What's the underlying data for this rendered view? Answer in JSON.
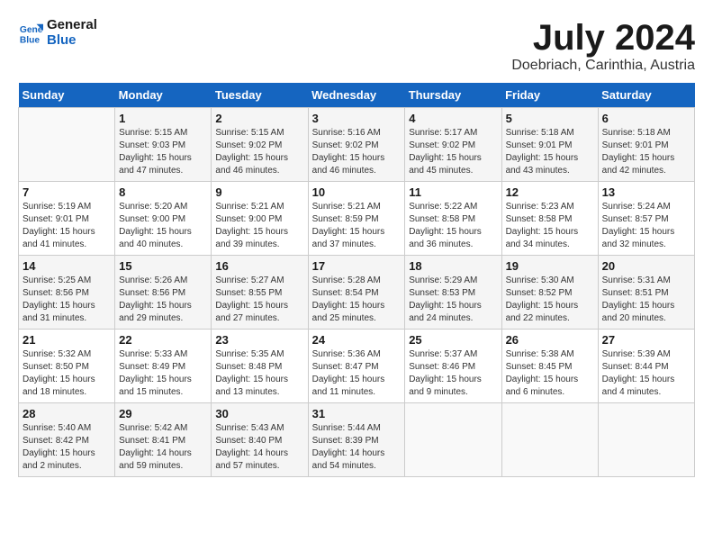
{
  "logo": {
    "line1": "General",
    "line2": "Blue"
  },
  "title": "July 2024",
  "location": "Doebriach, Carinthia, Austria",
  "weekdays": [
    "Sunday",
    "Monday",
    "Tuesday",
    "Wednesday",
    "Thursday",
    "Friday",
    "Saturday"
  ],
  "weeks": [
    [
      {
        "day": "",
        "info": ""
      },
      {
        "day": "1",
        "info": "Sunrise: 5:15 AM\nSunset: 9:03 PM\nDaylight: 15 hours\nand 47 minutes."
      },
      {
        "day": "2",
        "info": "Sunrise: 5:15 AM\nSunset: 9:02 PM\nDaylight: 15 hours\nand 46 minutes."
      },
      {
        "day": "3",
        "info": "Sunrise: 5:16 AM\nSunset: 9:02 PM\nDaylight: 15 hours\nand 46 minutes."
      },
      {
        "day": "4",
        "info": "Sunrise: 5:17 AM\nSunset: 9:02 PM\nDaylight: 15 hours\nand 45 minutes."
      },
      {
        "day": "5",
        "info": "Sunrise: 5:18 AM\nSunset: 9:01 PM\nDaylight: 15 hours\nand 43 minutes."
      },
      {
        "day": "6",
        "info": "Sunrise: 5:18 AM\nSunset: 9:01 PM\nDaylight: 15 hours\nand 42 minutes."
      }
    ],
    [
      {
        "day": "7",
        "info": "Sunrise: 5:19 AM\nSunset: 9:01 PM\nDaylight: 15 hours\nand 41 minutes."
      },
      {
        "day": "8",
        "info": "Sunrise: 5:20 AM\nSunset: 9:00 PM\nDaylight: 15 hours\nand 40 minutes."
      },
      {
        "day": "9",
        "info": "Sunrise: 5:21 AM\nSunset: 9:00 PM\nDaylight: 15 hours\nand 39 minutes."
      },
      {
        "day": "10",
        "info": "Sunrise: 5:21 AM\nSunset: 8:59 PM\nDaylight: 15 hours\nand 37 minutes."
      },
      {
        "day": "11",
        "info": "Sunrise: 5:22 AM\nSunset: 8:58 PM\nDaylight: 15 hours\nand 36 minutes."
      },
      {
        "day": "12",
        "info": "Sunrise: 5:23 AM\nSunset: 8:58 PM\nDaylight: 15 hours\nand 34 minutes."
      },
      {
        "day": "13",
        "info": "Sunrise: 5:24 AM\nSunset: 8:57 PM\nDaylight: 15 hours\nand 32 minutes."
      }
    ],
    [
      {
        "day": "14",
        "info": "Sunrise: 5:25 AM\nSunset: 8:56 PM\nDaylight: 15 hours\nand 31 minutes."
      },
      {
        "day": "15",
        "info": "Sunrise: 5:26 AM\nSunset: 8:56 PM\nDaylight: 15 hours\nand 29 minutes."
      },
      {
        "day": "16",
        "info": "Sunrise: 5:27 AM\nSunset: 8:55 PM\nDaylight: 15 hours\nand 27 minutes."
      },
      {
        "day": "17",
        "info": "Sunrise: 5:28 AM\nSunset: 8:54 PM\nDaylight: 15 hours\nand 25 minutes."
      },
      {
        "day": "18",
        "info": "Sunrise: 5:29 AM\nSunset: 8:53 PM\nDaylight: 15 hours\nand 24 minutes."
      },
      {
        "day": "19",
        "info": "Sunrise: 5:30 AM\nSunset: 8:52 PM\nDaylight: 15 hours\nand 22 minutes."
      },
      {
        "day": "20",
        "info": "Sunrise: 5:31 AM\nSunset: 8:51 PM\nDaylight: 15 hours\nand 20 minutes."
      }
    ],
    [
      {
        "day": "21",
        "info": "Sunrise: 5:32 AM\nSunset: 8:50 PM\nDaylight: 15 hours\nand 18 minutes."
      },
      {
        "day": "22",
        "info": "Sunrise: 5:33 AM\nSunset: 8:49 PM\nDaylight: 15 hours\nand 15 minutes."
      },
      {
        "day": "23",
        "info": "Sunrise: 5:35 AM\nSunset: 8:48 PM\nDaylight: 15 hours\nand 13 minutes."
      },
      {
        "day": "24",
        "info": "Sunrise: 5:36 AM\nSunset: 8:47 PM\nDaylight: 15 hours\nand 11 minutes."
      },
      {
        "day": "25",
        "info": "Sunrise: 5:37 AM\nSunset: 8:46 PM\nDaylight: 15 hours\nand 9 minutes."
      },
      {
        "day": "26",
        "info": "Sunrise: 5:38 AM\nSunset: 8:45 PM\nDaylight: 15 hours\nand 6 minutes."
      },
      {
        "day": "27",
        "info": "Sunrise: 5:39 AM\nSunset: 8:44 PM\nDaylight: 15 hours\nand 4 minutes."
      }
    ],
    [
      {
        "day": "28",
        "info": "Sunrise: 5:40 AM\nSunset: 8:42 PM\nDaylight: 15 hours\nand 2 minutes."
      },
      {
        "day": "29",
        "info": "Sunrise: 5:42 AM\nSunset: 8:41 PM\nDaylight: 14 hours\nand 59 minutes."
      },
      {
        "day": "30",
        "info": "Sunrise: 5:43 AM\nSunset: 8:40 PM\nDaylight: 14 hours\nand 57 minutes."
      },
      {
        "day": "31",
        "info": "Sunrise: 5:44 AM\nSunset: 8:39 PM\nDaylight: 14 hours\nand 54 minutes."
      },
      {
        "day": "",
        "info": ""
      },
      {
        "day": "",
        "info": ""
      },
      {
        "day": "",
        "info": ""
      }
    ]
  ]
}
